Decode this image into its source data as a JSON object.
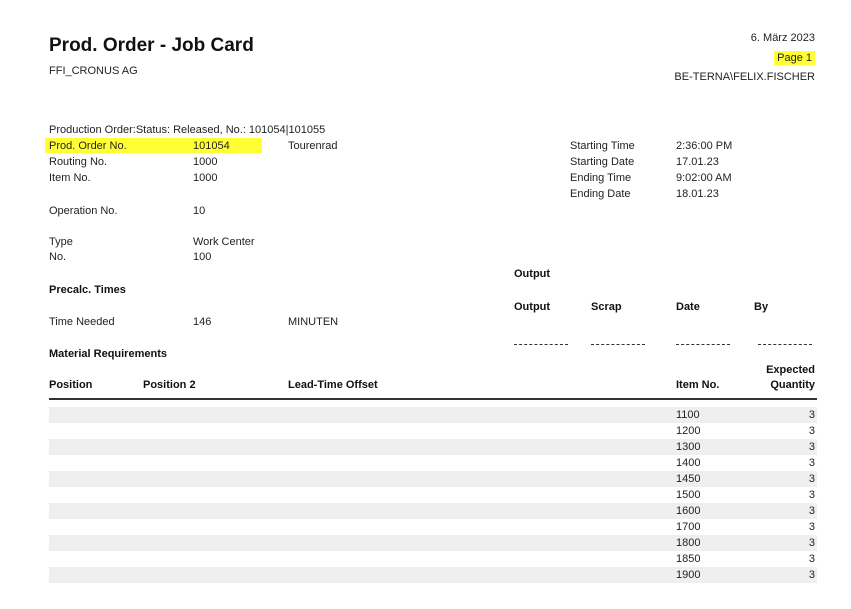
{
  "header": {
    "title": "Prod. Order - Job Card",
    "company": "FFI_CRONUS AG",
    "date": "6. März 2023",
    "page": "Page 1",
    "user": "BE-TERNA\\FELIX.FISCHER"
  },
  "filter_line": "Production Order:Status: Released, No.: 101054|101055",
  "fields": {
    "prod_order_no_label": "Prod. Order No.",
    "prod_order_no_value": "101054",
    "prod_order_desc": "Tourenrad",
    "routing_no_label": "Routing No.",
    "routing_no_value": "1000",
    "item_no_label": "Item No.",
    "item_no_value": "1000",
    "operation_no_label": "Operation No.",
    "operation_no_value": "10",
    "type_label": "Type",
    "type_value": "Work Center",
    "no_label": "No.",
    "no_value": "100"
  },
  "times": {
    "starting_time_label": "Starting Time",
    "starting_time_value": "2:36:00 PM",
    "starting_date_label": "Starting Date",
    "starting_date_value": "17.01.23",
    "ending_time_label": "Ending Time",
    "ending_time_value": "9:02:00 AM",
    "ending_date_label": "Ending Date",
    "ending_date_value": "18.01.23"
  },
  "precalc": {
    "heading": "Precalc. Times",
    "time_needed_label": "Time Needed",
    "time_needed_value": "146",
    "time_needed_unit": "MINUTEN"
  },
  "output": {
    "heading": "Output",
    "col_output": "Output",
    "col_scrap": "Scrap",
    "col_date": "Date",
    "col_by": "By"
  },
  "material": {
    "heading": "Material Requirements",
    "col_position": "Position",
    "col_position2": "Position 2",
    "col_lead_time": "Lead-Time Offset",
    "col_item_no": "Item No.",
    "col_expected_1": "Expected",
    "col_expected_2": "Quantity",
    "rows": [
      {
        "item_no": "1100",
        "qty": "3"
      },
      {
        "item_no": "1200",
        "qty": "3"
      },
      {
        "item_no": "1300",
        "qty": "3"
      },
      {
        "item_no": "1400",
        "qty": "3"
      },
      {
        "item_no": "1450",
        "qty": "3"
      },
      {
        "item_no": "1500",
        "qty": "3"
      },
      {
        "item_no": "1600",
        "qty": "3"
      },
      {
        "item_no": "1700",
        "qty": "3"
      },
      {
        "item_no": "1800",
        "qty": "3"
      },
      {
        "item_no": "1850",
        "qty": "3"
      },
      {
        "item_no": "1900",
        "qty": "3"
      }
    ]
  },
  "colors": {
    "highlight": "#ffff33",
    "row_shade": "#efefef"
  }
}
